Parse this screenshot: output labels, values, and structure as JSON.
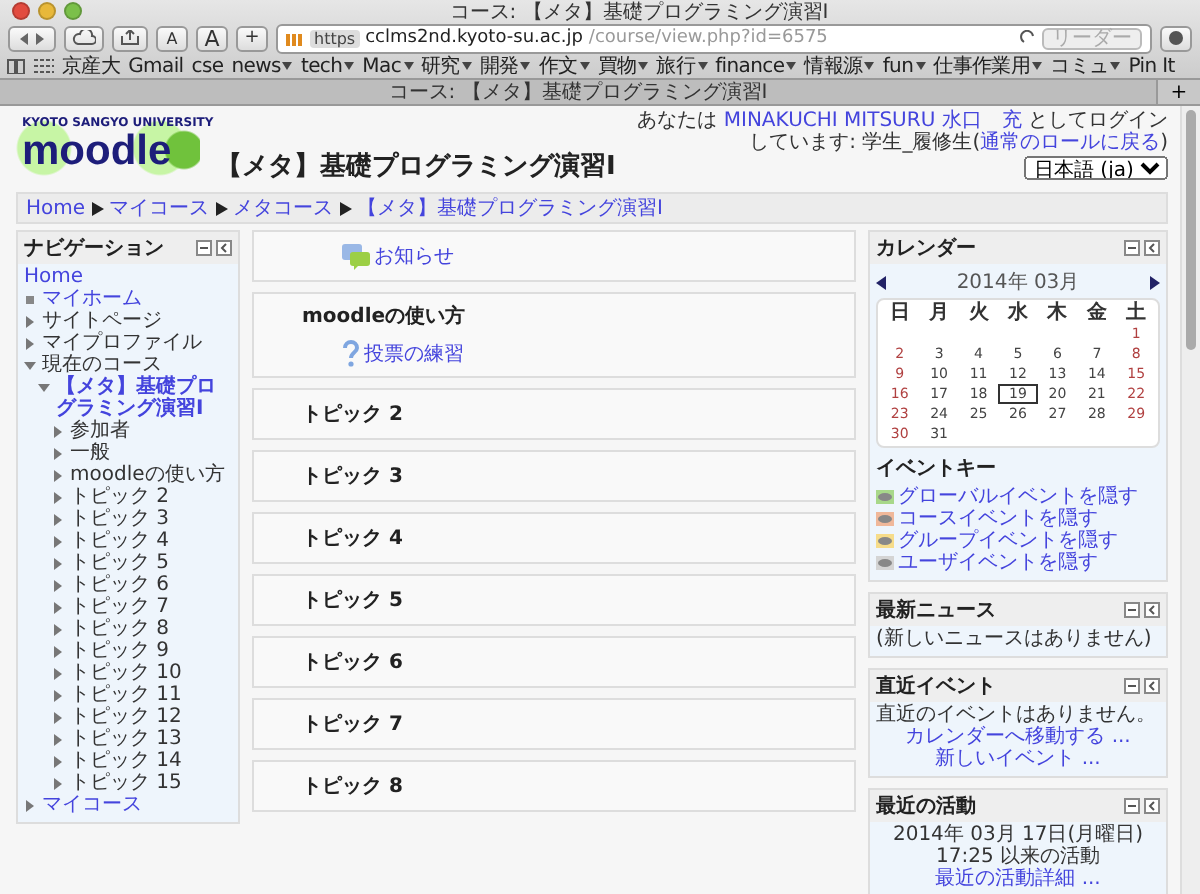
{
  "browser": {
    "window_title": "コース: 【メタ】基礎プログラミング演習I",
    "font_buttons": [
      "A",
      "A"
    ],
    "add_button": "+",
    "url_scheme": "https",
    "url_host": "cclms2nd.kyoto-su.ac.jp",
    "url_path": "/course/view.php?id=6575",
    "reader_button": "リーダー",
    "bookmarks": [
      {
        "label": "京産大",
        "menu": false
      },
      {
        "label": "Gmail",
        "menu": false
      },
      {
        "label": "cse",
        "menu": false
      },
      {
        "label": "news",
        "menu": true
      },
      {
        "label": "tech",
        "menu": true
      },
      {
        "label": "Mac",
        "menu": true
      },
      {
        "label": "研究",
        "menu": true
      },
      {
        "label": "開発",
        "menu": true
      },
      {
        "label": "作文",
        "menu": true
      },
      {
        "label": "買物",
        "menu": true
      },
      {
        "label": "旅行",
        "menu": true
      },
      {
        "label": "finance",
        "menu": true
      },
      {
        "label": "情報源",
        "menu": true
      },
      {
        "label": "fun",
        "menu": true
      },
      {
        "label": "仕事作業用",
        "menu": true
      },
      {
        "label": "コミュ",
        "menu": true
      },
      {
        "label": "Pin It",
        "menu": false
      }
    ],
    "tab_title": "コース: 【メタ】基礎プログラミング演習I",
    "new_tab": "+"
  },
  "header": {
    "logo_top": "KYOTO SANGYO UNIVERSITY",
    "logo": "moodle",
    "course_title": "【メタ】基礎プログラミング演習I",
    "login_prefix": "あなたは",
    "login_user": "MINAKUCHI MITSURU 水口　充",
    "login_middle": "としてログインしています: 学生_履修生(",
    "login_link": "通常のロールに戻る",
    "login_suffix": ")",
    "language": "日本語 (ja)"
  },
  "breadcrumb": [
    "Home",
    "マイコース",
    "メタコース",
    "【メタ】基礎プログラミング演習I"
  ],
  "navigation": {
    "title": "ナビゲーション",
    "items": [
      {
        "label": "Home",
        "kind": "plain",
        "link": true
      },
      {
        "label": "マイホーム",
        "kind": "bullet",
        "link": true
      },
      {
        "label": "サイトページ",
        "kind": "node",
        "link": false,
        "expanded": false
      },
      {
        "label": "マイプロファイル",
        "kind": "node",
        "link": false,
        "expanded": false
      },
      {
        "label": "現在のコース",
        "kind": "node",
        "link": false,
        "expanded": true,
        "children": [
          {
            "label": "【メタ】基礎プログラミング演習I",
            "kind": "node",
            "link": true,
            "expanded": true,
            "children": [
              {
                "label": "参加者",
                "kind": "node",
                "link": false,
                "expanded": false
              },
              {
                "label": "一般",
                "kind": "node",
                "link": false,
                "expanded": false
              },
              {
                "label": "moodleの使い方",
                "kind": "node",
                "link": false,
                "expanded": false
              },
              {
                "label": "トピック 2",
                "kind": "node",
                "link": false,
                "expanded": false
              },
              {
                "label": "トピック 3",
                "kind": "node",
                "link": false,
                "expanded": false
              },
              {
                "label": "トピック 4",
                "kind": "node",
                "link": false,
                "expanded": false
              },
              {
                "label": "トピック 5",
                "kind": "node",
                "link": false,
                "expanded": false
              },
              {
                "label": "トピック 6",
                "kind": "node",
                "link": false,
                "expanded": false
              },
              {
                "label": "トピック 7",
                "kind": "node",
                "link": false,
                "expanded": false
              },
              {
                "label": "トピック 8",
                "kind": "node",
                "link": false,
                "expanded": false
              },
              {
                "label": "トピック 9",
                "kind": "node",
                "link": false,
                "expanded": false
              },
              {
                "label": "トピック 10",
                "kind": "node",
                "link": false,
                "expanded": false
              },
              {
                "label": "トピック 11",
                "kind": "node",
                "link": false,
                "expanded": false
              },
              {
                "label": "トピック 12",
                "kind": "node",
                "link": false,
                "expanded": false
              },
              {
                "label": "トピック 13",
                "kind": "node",
                "link": false,
                "expanded": false
              },
              {
                "label": "トピック 14",
                "kind": "node",
                "link": false,
                "expanded": false
              },
              {
                "label": "トピック 15",
                "kind": "node",
                "link": false,
                "expanded": false
              }
            ]
          }
        ]
      },
      {
        "label": "マイコース",
        "kind": "node",
        "link": true,
        "expanded": false
      }
    ]
  },
  "sections": [
    {
      "activities": [
        {
          "label": "お知らせ",
          "kind": "forum"
        }
      ]
    },
    {
      "title": "moodleの使い方",
      "activities": [
        {
          "label": "投票の練習",
          "kind": "question"
        }
      ]
    },
    {
      "title": "トピック 2"
    },
    {
      "title": "トピック 3"
    },
    {
      "title": "トピック 4"
    },
    {
      "title": "トピック 5"
    },
    {
      "title": "トピック 6"
    },
    {
      "title": "トピック 7"
    },
    {
      "title": "トピック 8"
    }
  ],
  "calendar": {
    "title": "カレンダー",
    "month": "2014年 03月",
    "weekdays": [
      "日",
      "月",
      "火",
      "水",
      "木",
      "金",
      "土"
    ],
    "days": [
      {
        "kind": "blank"
      },
      {
        "kind": "blank"
      },
      {
        "kind": "blank"
      },
      {
        "kind": "blank"
      },
      {
        "kind": "blank"
      },
      {
        "kind": "blank"
      },
      {
        "kind": "date",
        "day": "1",
        "today": false
      },
      {
        "kind": "date",
        "day": "2",
        "today": false
      },
      {
        "kind": "date",
        "day": "3",
        "today": false
      },
      {
        "kind": "date",
        "day": "4",
        "today": false
      },
      {
        "kind": "date",
        "day": "5",
        "today": false
      },
      {
        "kind": "date",
        "day": "6",
        "today": false
      },
      {
        "kind": "date",
        "day": "7",
        "today": false
      },
      {
        "kind": "date",
        "day": "8",
        "today": false
      },
      {
        "kind": "date",
        "day": "9",
        "today": false
      },
      {
        "kind": "date",
        "day": "10",
        "today": false
      },
      {
        "kind": "date",
        "day": "11",
        "today": false
      },
      {
        "kind": "date",
        "day": "12",
        "today": false
      },
      {
        "kind": "date",
        "day": "13",
        "today": false
      },
      {
        "kind": "date",
        "day": "14",
        "today": false
      },
      {
        "kind": "date",
        "day": "15",
        "today": false
      },
      {
        "kind": "date",
        "day": "16",
        "today": false
      },
      {
        "kind": "date",
        "day": "17",
        "today": false
      },
      {
        "kind": "date",
        "day": "18",
        "today": false
      },
      {
        "kind": "date",
        "day": "19",
        "today": true
      },
      {
        "kind": "date",
        "day": "20",
        "today": false
      },
      {
        "kind": "date",
        "day": "21",
        "today": false
      },
      {
        "kind": "date",
        "day": "22",
        "today": false
      },
      {
        "kind": "date",
        "day": "23",
        "today": false
      },
      {
        "kind": "date",
        "day": "24",
        "today": false
      },
      {
        "kind": "date",
        "day": "25",
        "today": false
      },
      {
        "kind": "date",
        "day": "26",
        "today": false
      },
      {
        "kind": "date",
        "day": "27",
        "today": false
      },
      {
        "kind": "date",
        "day": "28",
        "today": false
      },
      {
        "kind": "date",
        "day": "29",
        "today": false
      },
      {
        "kind": "date",
        "day": "30",
        "today": false
      },
      {
        "kind": "date",
        "day": "31",
        "today": false
      }
    ],
    "event_key_title": "イベントキー",
    "event_keys": [
      {
        "label": "グローバルイベントを隠す",
        "color": "#a8d88a"
      },
      {
        "label": "コースイベントを隠す",
        "color": "#f0b89a"
      },
      {
        "label": "グループイベントを隠す",
        "color": "#f6dc8a"
      },
      {
        "label": "ユーザイベントを隠す",
        "color": "#d4d4d4"
      }
    ]
  },
  "news": {
    "title": "最新ニュース",
    "text": "(新しいニュースはありません)"
  },
  "upcoming": {
    "title": "直近イベント",
    "text": "直近のイベントはありません。",
    "links": [
      "カレンダーへ移動する ...",
      "新しいイベント ..."
    ]
  },
  "recent": {
    "title": "最近の活動",
    "lines": [
      "2014年 03月 17日(月曜日)",
      "17:25 以来の活動"
    ],
    "link": "最近の活動詳細 ..."
  }
}
